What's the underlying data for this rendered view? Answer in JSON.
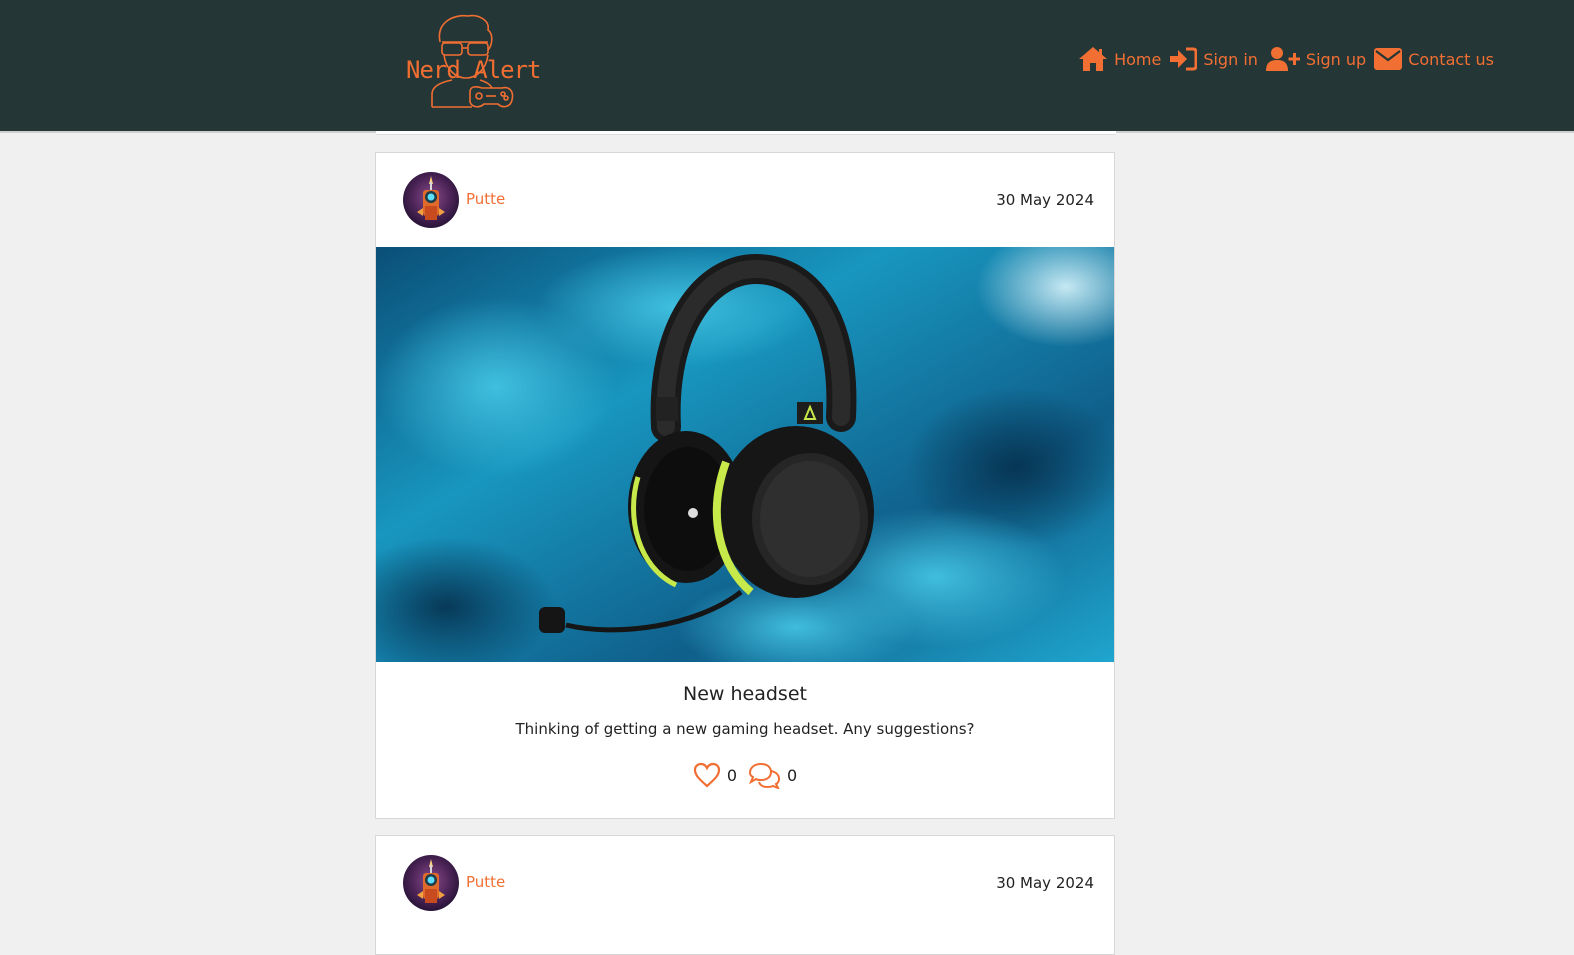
{
  "brand": {
    "logo_text": "Nerd Alert",
    "color": "#f26f33"
  },
  "colors": {
    "navbar_bg": "#243636",
    "accent": "#f26f33",
    "page_bg": "#f0f0f0"
  },
  "nav": {
    "items": [
      {
        "label": "Home",
        "icon": "home-icon"
      },
      {
        "label": "Sign in",
        "icon": "sign-in-icon"
      },
      {
        "label": "Sign up",
        "icon": "user-plus-icon"
      },
      {
        "label": "Contact us",
        "icon": "envelope-icon"
      }
    ]
  },
  "posts": [
    {
      "author": "Putte",
      "date": "30 May 2024",
      "image": "headset-photo",
      "title": "New headset",
      "body": "Thinking of getting a new gaming headset. Any suggestions?",
      "likes": "0",
      "comments": "0"
    },
    {
      "author": "Putte",
      "date": "30 May 2024"
    }
  ]
}
